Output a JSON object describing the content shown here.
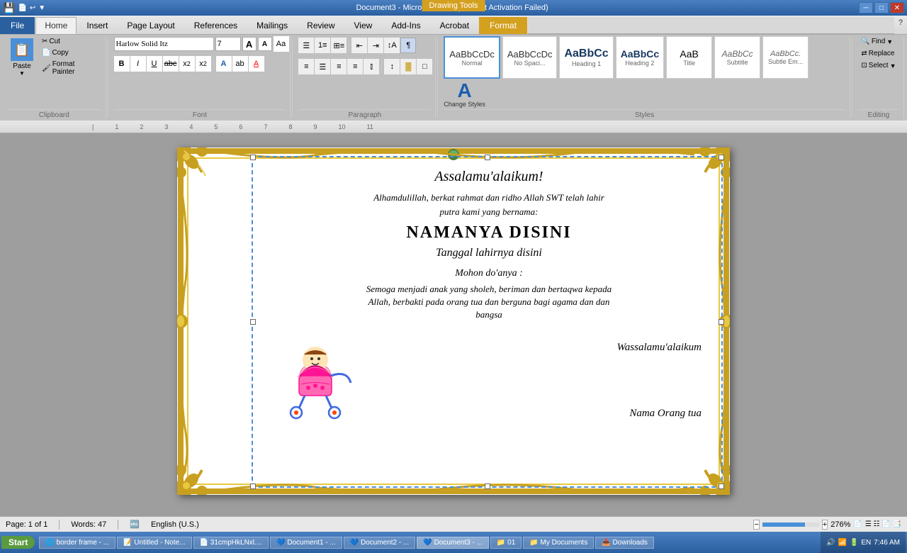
{
  "titleBar": {
    "title": "Document3 - Microsoft Word (Product Activation Failed)",
    "drawingTools": "Drawing Tools"
  },
  "tabs": {
    "file": "File",
    "home": "Home",
    "insert": "Insert",
    "pageLayout": "Page Layout",
    "references": "References",
    "mailings": "Mailings",
    "review": "Review",
    "view": "View",
    "addIns": "Add-Ins",
    "acrobat": "Acrobat",
    "format": "Format"
  },
  "clipboard": {
    "paste": "Paste",
    "cut": "Cut",
    "copy": "Copy",
    "formatPainter": "Format Painter",
    "label": "Clipboard"
  },
  "font": {
    "name": "Harlow Solid Itz",
    "size": "7",
    "label": "Font",
    "bold": "B",
    "italic": "I",
    "underline": "U",
    "strikethrough": "abc",
    "subscript": "x₂",
    "superscript": "x²"
  },
  "paragraph": {
    "label": "Paragraph"
  },
  "styles": {
    "label": "Styles",
    "normal": "¶ Normal",
    "normalLabel": "Normal",
    "noSpacing": "No Spaci...",
    "heading1": "Heading 1",
    "heading2": "Heading 2",
    "title": "Title",
    "subtitle": "Subtitle",
    "subtleEm": "Subtle Em...",
    "changeStyles": "Change Styles"
  },
  "editing": {
    "label": "Editing",
    "find": "Find",
    "replace": "Replace",
    "select": "Select"
  },
  "document": {
    "greeting": "Assalamu'alaikum!",
    "line1": "Alhamdulillah, berkat rahmat dan ridho Allah SWT telah lahir",
    "line2": "putra kami yang bernama:",
    "name": "NAMANYA DISINI",
    "date": "Tanggal lahirnya disini",
    "prayer_intro": "Mohon do'anya :",
    "prayer1": "Semoga menjadi anak yang sholeh, beriman dan bertaqwa kepada",
    "prayer2": "Allah, berbakti pada orang tua dan berguna bagi agama dan dan",
    "prayer3": "bangsa",
    "wassalam": "Wassalamu'alaikum",
    "parent": "Nama Orang tua"
  },
  "statusBar": {
    "page": "Page: 1 of 1",
    "words": "Words: 47",
    "language": "English (U.S.)",
    "zoom": "276%"
  },
  "taskbar": {
    "start": "Start",
    "items": [
      "border frame - ...",
      "Untitled - Note...",
      "31cmpHkLNxl....",
      "Document1 - ...",
      "Document2 - ...",
      "Document3 - ...",
      "01",
      "My Documents",
      "Downloads"
    ],
    "tray": "7:46 AM"
  }
}
